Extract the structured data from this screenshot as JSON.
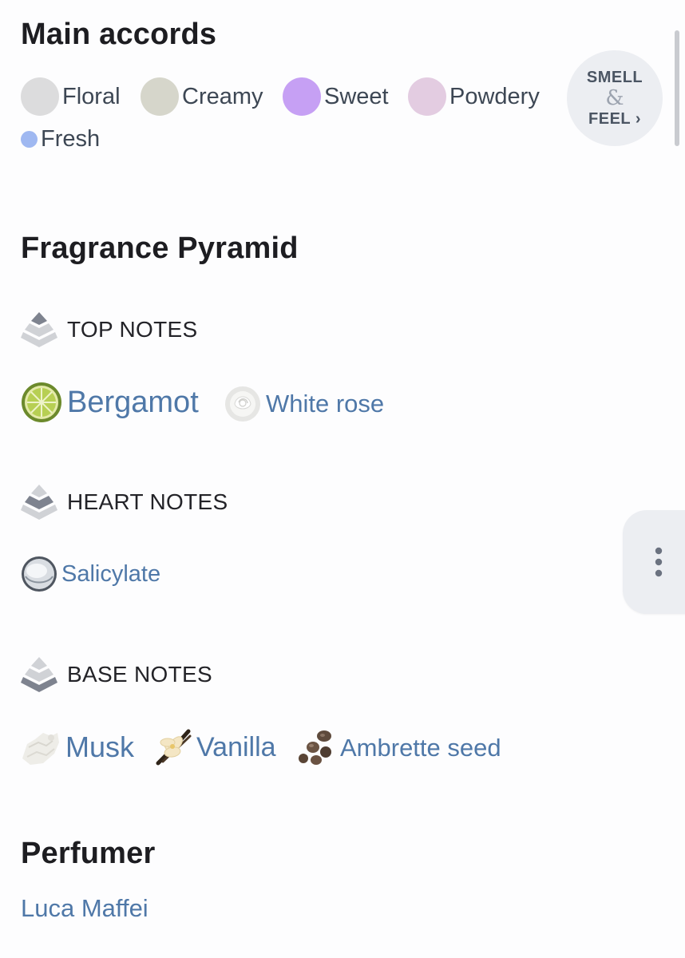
{
  "main_accords": {
    "title": "Main accords",
    "items": [
      {
        "label": "Floral",
        "color": "#dcdcdd"
      },
      {
        "label": "Creamy",
        "color": "#d6d6cb"
      },
      {
        "label": "Sweet",
        "color": "#c6a0f4"
      },
      {
        "label": "Powdery",
        "color": "#e3cce1"
      },
      {
        "label": "Fresh",
        "color": "#9fb8f1"
      }
    ],
    "smell_feel": {
      "line1": "SMELL",
      "line2": "&",
      "line3": "FEEL ›"
    }
  },
  "pyramid": {
    "title": "Fragrance Pyramid",
    "top": {
      "heading": "TOP NOTES",
      "notes": [
        {
          "label": "Bergamot",
          "icon": "bergamot-icon"
        },
        {
          "label": "White rose",
          "icon": "white-rose-icon"
        }
      ]
    },
    "heart": {
      "heading": "HEART NOTES",
      "notes": [
        {
          "label": "Salicylate",
          "icon": "salicylate-icon"
        }
      ]
    },
    "base": {
      "heading": "BASE NOTES",
      "notes": [
        {
          "label": "Musk",
          "icon": "musk-icon"
        },
        {
          "label": "Vanilla",
          "icon": "vanilla-icon"
        },
        {
          "label": "Ambrette seed",
          "icon": "ambrette-seed-icon"
        }
      ]
    }
  },
  "perfumer": {
    "title": "Perfumer",
    "name": "Luca Maffei"
  },
  "colors": {
    "link": "#4f78a8",
    "heading": "#1d1d21"
  }
}
